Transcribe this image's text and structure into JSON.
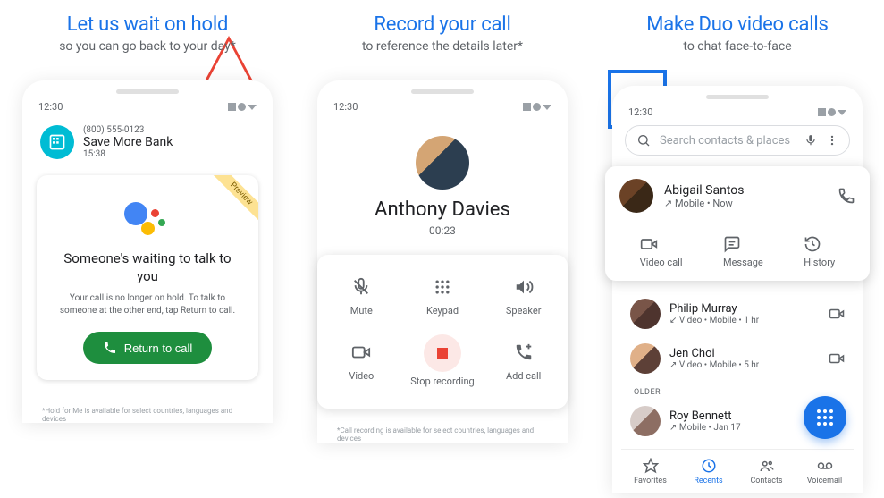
{
  "panel1": {
    "heading": "Let us wait on hold",
    "subheading": "so you can go back to your day*",
    "status_time": "12:30",
    "bank_number": "(800) 555-0123",
    "bank_name": "Save More Bank",
    "bank_time": "15:38",
    "ribbon": "Preview",
    "card_title": "Someone's waiting to talk to you",
    "card_body": "Your call is no longer on hold. To talk to someone at the other end, tap Return to call.",
    "return_btn": "Return to call",
    "footnote": "*Hold for Me is available for select countries, languages and devices"
  },
  "panel2": {
    "heading": "Record your call",
    "subheading": "to reference the details later*",
    "status_time": "12:30",
    "caller_name": "Anthony Davies",
    "call_time": "00:23",
    "mute": "Mute",
    "keypad": "Keypad",
    "speaker": "Speaker",
    "video": "Video",
    "stop_rec": "Stop recording",
    "add_call": "Add call",
    "footnote": "*Call recording is available for select countries, languages and devices"
  },
  "panel3": {
    "heading": "Make Duo video calls",
    "subheading": "to chat face-to-face",
    "status_time": "12:30",
    "search_placeholder": "Search contacts & places",
    "contact_name": "Abigail Santos",
    "contact_meta": "↗ Mobile • Now",
    "video_call": "Video call",
    "message": "Message",
    "history": "History",
    "recents": [
      {
        "name": "Philip Murray",
        "meta": "↙ Video • Mobile • 1 hr"
      },
      {
        "name": "Jen Choi",
        "meta": "↗ Video • Mobile • 5 hr"
      }
    ],
    "older_hdr": "OLDER",
    "older": {
      "name": "Roy Bennett",
      "meta": "↗ Mobile • Jan 17"
    },
    "nav": {
      "favorites": "Favorites",
      "recents": "Recents",
      "contacts": "Contacts",
      "voicemail": "Voicemail"
    }
  }
}
